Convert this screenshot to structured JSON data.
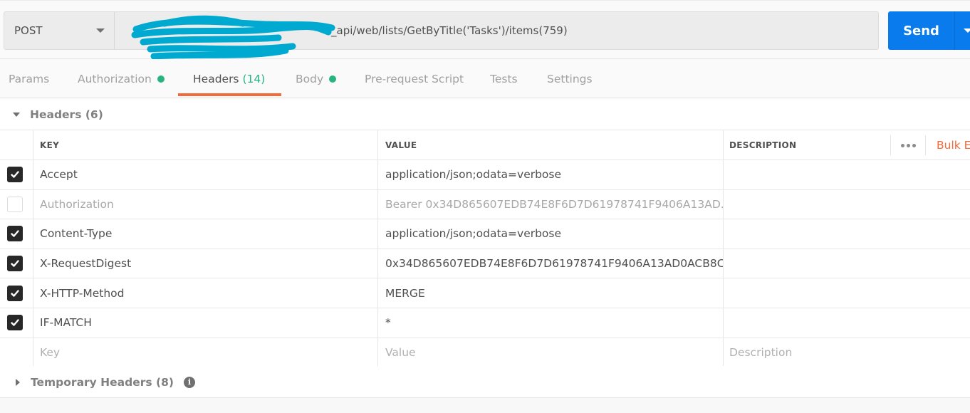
{
  "request": {
    "method": "POST",
    "url_visible": "_api/web/lists/GetByTitle('Tasks')/items(759)",
    "url_redacted": true,
    "send_label": "Send"
  },
  "tabs": [
    {
      "label": "Params",
      "count": null,
      "dot": false,
      "active": false
    },
    {
      "label": "Authorization",
      "count": null,
      "dot": true,
      "active": false
    },
    {
      "label": "Headers",
      "count": "(14)",
      "dot": false,
      "active": true
    },
    {
      "label": "Body",
      "count": null,
      "dot": true,
      "active": false
    },
    {
      "label": "Pre-request Script",
      "count": null,
      "dot": false,
      "active": false
    },
    {
      "label": "Tests",
      "count": null,
      "dot": false,
      "active": false
    },
    {
      "label": "Settings",
      "count": null,
      "dot": false,
      "active": false
    }
  ],
  "headers_section": {
    "title": "Headers",
    "count": "(6)",
    "expanded": true
  },
  "table": {
    "columns": {
      "key": "KEY",
      "value": "VALUE",
      "description": "DESCRIPTION"
    },
    "more_label": "more-actions",
    "bulk_edit_label": "Bulk Edit",
    "rows": [
      {
        "enabled": true,
        "key": "Accept",
        "value": "application/json;odata=verbose",
        "description": ""
      },
      {
        "enabled": false,
        "key": "Authorization",
        "value": "Bearer 0x34D865607EDB74E8F6D7D61978741F9406A13AD...",
        "description": ""
      },
      {
        "enabled": true,
        "key": "Content-Type",
        "value": "application/json;odata=verbose",
        "description": ""
      },
      {
        "enabled": true,
        "key": "X-RequestDigest",
        "value": "0x34D865607EDB74E8F6D7D61978741F9406A13AD0ACB8C...",
        "description": ""
      },
      {
        "enabled": true,
        "key": "X-HTTP-Method",
        "value": "MERGE",
        "description": ""
      },
      {
        "enabled": true,
        "key": "IF-MATCH",
        "value": "*",
        "description": ""
      }
    ],
    "new_row": {
      "key_placeholder": "Key",
      "value_placeholder": "Value",
      "description_placeholder": "Description"
    }
  },
  "temporary_section": {
    "title": "Temporary Headers",
    "count": "(8)",
    "expanded": false,
    "info_icon": "i"
  },
  "colors": {
    "accent_orange": "#f26b3a",
    "send_blue": "#097bed",
    "status_green": "#26b47f"
  }
}
